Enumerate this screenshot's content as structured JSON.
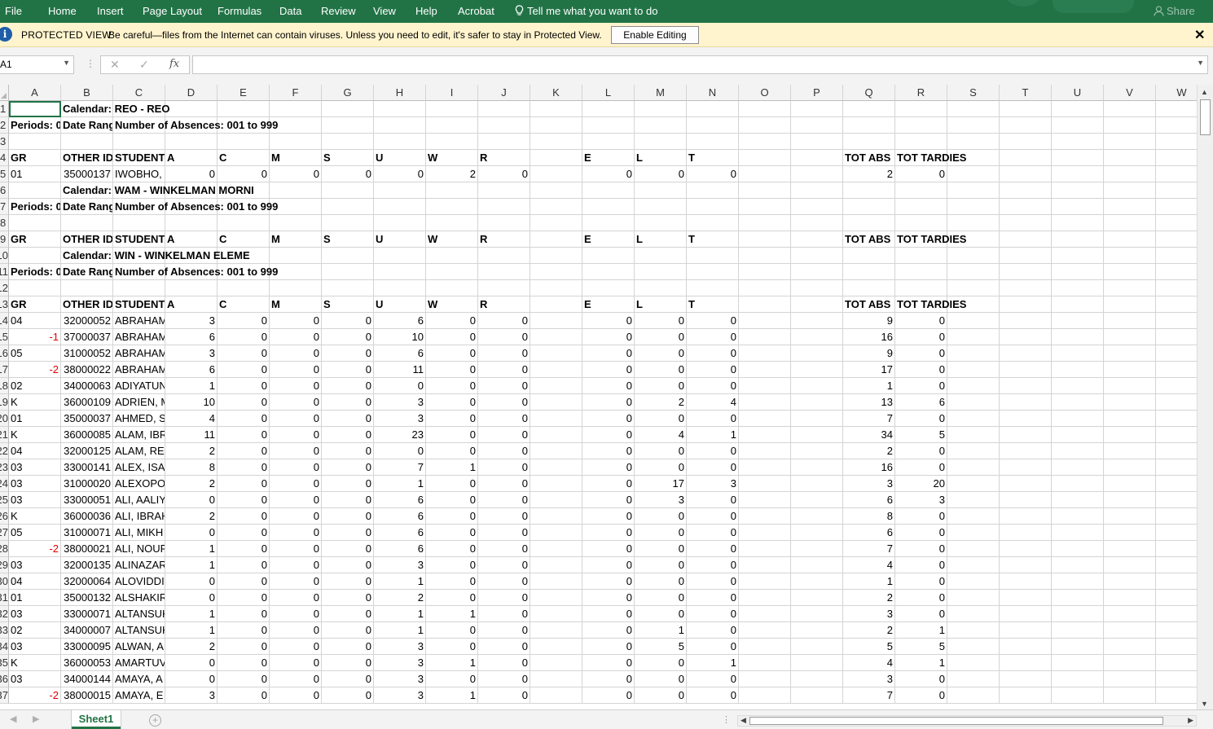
{
  "ribbon": {
    "tabs": [
      "File",
      "Home",
      "Insert",
      "Page Layout",
      "Formulas",
      "Data",
      "Review",
      "View",
      "Help",
      "Acrobat"
    ],
    "tell_me": "Tell me what you want to do",
    "share": "Share"
  },
  "protected_view": {
    "title": "PROTECTED VIEW",
    "message": "Be careful—files from the Internet can contain viruses. Unless you need to edit, it's safer to stay in Protected View.",
    "enable_button": "Enable Editing",
    "close_glyph": "✕"
  },
  "formula_bar": {
    "name_box": "A1",
    "formula": "",
    "fx_label": "fx"
  },
  "columns": [
    "A",
    "B",
    "C",
    "D",
    "E",
    "F",
    "G",
    "H",
    "I",
    "J",
    "K",
    "L",
    "M",
    "N",
    "O",
    "P",
    "Q",
    "R",
    "S",
    "T",
    "U",
    "V",
    "W"
  ],
  "rows": [
    {
      "n": "1",
      "cells": {
        "B": {
          "v": "Calendar: REO - REO",
          "b": true
        }
      }
    },
    {
      "n": "2",
      "cells": {
        "A": {
          "v": "Periods: 0",
          "b": true
        },
        "B": {
          "v": "Date Rang",
          "b": true
        },
        "C": {
          "v": "Number of Absences: 001 to 999",
          "b": true
        }
      }
    },
    {
      "n": "3",
      "cells": {}
    },
    {
      "n": "4",
      "cells": {
        "A": {
          "v": "GR",
          "b": true
        },
        "B": {
          "v": "OTHER ID",
          "b": true
        },
        "C": {
          "v": "STUDENT",
          "b": true
        },
        "D": {
          "v": "A",
          "b": true
        },
        "E": {
          "v": "C",
          "b": true
        },
        "F": {
          "v": "M",
          "b": true
        },
        "G": {
          "v": "S",
          "b": true
        },
        "H": {
          "v": "U",
          "b": true
        },
        "I": {
          "v": "W",
          "b": true
        },
        "J": {
          "v": "R",
          "b": true
        },
        "L": {
          "v": "E",
          "b": true
        },
        "M": {
          "v": "L",
          "b": true
        },
        "N": {
          "v": "T",
          "b": true
        },
        "Q": {
          "v": "TOT ABS",
          "b": true
        },
        "R": {
          "v": "TOT TARDIES",
          "b": true
        }
      }
    },
    {
      "n": "5",
      "cells": {
        "A": {
          "v": "01"
        },
        "B": {
          "v": "35000137",
          "num": true
        },
        "C": {
          "v": "IWOBHO,",
          "clip": true
        },
        "D": {
          "v": "0",
          "num": true
        },
        "E": {
          "v": "0",
          "num": true
        },
        "F": {
          "v": "0",
          "num": true
        },
        "G": {
          "v": "0",
          "num": true
        },
        "H": {
          "v": "0",
          "num": true
        },
        "I": {
          "v": "2",
          "num": true
        },
        "J": {
          "v": "0",
          "num": true
        },
        "L": {
          "v": "0",
          "num": true
        },
        "M": {
          "v": "0",
          "num": true
        },
        "N": {
          "v": "0",
          "num": true
        },
        "Q": {
          "v": "2",
          "num": true
        },
        "R": {
          "v": "0",
          "num": true
        }
      }
    },
    {
      "n": "6",
      "cells": {
        "B": {
          "v": "Calendar: WAM - WINKELMAN MORNI",
          "b": true
        }
      }
    },
    {
      "n": "7",
      "cells": {
        "A": {
          "v": "Periods: 0",
          "b": true
        },
        "B": {
          "v": "Date Rang",
          "b": true
        },
        "C": {
          "v": "Number of Absences: 001 to 999",
          "b": true
        }
      }
    },
    {
      "n": "8",
      "cells": {}
    },
    {
      "n": "9",
      "cells": {
        "A": {
          "v": "GR",
          "b": true
        },
        "B": {
          "v": "OTHER ID",
          "b": true
        },
        "C": {
          "v": "STUDENT",
          "b": true
        },
        "D": {
          "v": "A",
          "b": true
        },
        "E": {
          "v": "C",
          "b": true
        },
        "F": {
          "v": "M",
          "b": true
        },
        "G": {
          "v": "S",
          "b": true
        },
        "H": {
          "v": "U",
          "b": true
        },
        "I": {
          "v": "W",
          "b": true
        },
        "J": {
          "v": "R",
          "b": true
        },
        "L": {
          "v": "E",
          "b": true
        },
        "M": {
          "v": "L",
          "b": true
        },
        "N": {
          "v": "T",
          "b": true
        },
        "Q": {
          "v": "TOT ABS",
          "b": true
        },
        "R": {
          "v": "TOT TARDIES",
          "b": true
        }
      }
    },
    {
      "n": "10",
      "cells": {
        "B": {
          "v": "Calendar: WIN - WINKELMAN ELEME",
          "b": true
        }
      }
    },
    {
      "n": "11",
      "cells": {
        "A": {
          "v": "Periods: 0",
          "b": true
        },
        "B": {
          "v": "Date Rang",
          "b": true
        },
        "C": {
          "v": "Number of Absences: 001 to 999",
          "b": true
        }
      }
    },
    {
      "n": "12",
      "cells": {}
    },
    {
      "n": "13",
      "cells": {
        "A": {
          "v": "GR",
          "b": true
        },
        "B": {
          "v": "OTHER ID",
          "b": true
        },
        "C": {
          "v": "STUDENT",
          "b": true
        },
        "D": {
          "v": "A",
          "b": true
        },
        "E": {
          "v": "C",
          "b": true
        },
        "F": {
          "v": "M",
          "b": true
        },
        "G": {
          "v": "S",
          "b": true
        },
        "H": {
          "v": "U",
          "b": true
        },
        "I": {
          "v": "W",
          "b": true
        },
        "J": {
          "v": "R",
          "b": true
        },
        "L": {
          "v": "E",
          "b": true
        },
        "M": {
          "v": "L",
          "b": true
        },
        "N": {
          "v": "T",
          "b": true
        },
        "Q": {
          "v": "TOT ABS",
          "b": true
        },
        "R": {
          "v": "TOT TARDIES",
          "b": true
        }
      }
    },
    {
      "n": "14",
      "gr": "04",
      "id": "32000052",
      "st": "ABRAHAM",
      "d": [
        "3",
        "0",
        "0",
        "0",
        "6",
        "0",
        "0"
      ],
      "t": [
        "0",
        "0",
        "0"
      ],
      "q": "9",
      "r": "0"
    },
    {
      "n": "15",
      "gr": "-1",
      "red": true,
      "id": "37000037",
      "st": "ABRAHAM",
      "d": [
        "6",
        "0",
        "0",
        "0",
        "10",
        "0",
        "0"
      ],
      "t": [
        "0",
        "0",
        "0"
      ],
      "q": "16",
      "r": "0"
    },
    {
      "n": "16",
      "gr": "05",
      "id": "31000052",
      "st": "ABRAHAM",
      "d": [
        "3",
        "0",
        "0",
        "0",
        "6",
        "0",
        "0"
      ],
      "t": [
        "0",
        "0",
        "0"
      ],
      "q": "9",
      "r": "0"
    },
    {
      "n": "17",
      "gr": "-2",
      "red": true,
      "id": "38000022",
      "st": "ABRAHAM",
      "d": [
        "6",
        "0",
        "0",
        "0",
        "11",
        "0",
        "0"
      ],
      "t": [
        "0",
        "0",
        "0"
      ],
      "q": "17",
      "r": "0"
    },
    {
      "n": "18",
      "gr": "02",
      "id": "34000063",
      "st": "ADIYATUN",
      "d": [
        "1",
        "0",
        "0",
        "0",
        "0",
        "0",
        "0"
      ],
      "t": [
        "0",
        "0",
        "0"
      ],
      "q": "1",
      "r": "0"
    },
    {
      "n": "19",
      "gr": "K",
      "id": "36000109",
      "st": "ADRIEN, M",
      "d": [
        "10",
        "0",
        "0",
        "0",
        "3",
        "0",
        "0"
      ],
      "t": [
        "0",
        "2",
        "4"
      ],
      "q": "13",
      "r": "6"
    },
    {
      "n": "20",
      "gr": "01",
      "id": "35000037",
      "st": "AHMED, S",
      "d": [
        "4",
        "0",
        "0",
        "0",
        "3",
        "0",
        "0"
      ],
      "t": [
        "0",
        "0",
        "0"
      ],
      "q": "7",
      "r": "0"
    },
    {
      "n": "21",
      "gr": "K",
      "id": "36000085",
      "st": "ALAM, IBR",
      "d": [
        "11",
        "0",
        "0",
        "0",
        "23",
        "0",
        "0"
      ],
      "t": [
        "0",
        "4",
        "1"
      ],
      "q": "34",
      "r": "5"
    },
    {
      "n": "22",
      "gr": "04",
      "id": "32000125",
      "st": "ALAM, REI",
      "d": [
        "2",
        "0",
        "0",
        "0",
        "0",
        "0",
        "0"
      ],
      "t": [
        "0",
        "0",
        "0"
      ],
      "q": "2",
      "r": "0"
    },
    {
      "n": "23",
      "gr": "03",
      "id": "33000141",
      "st": "ALEX, ISAE",
      "d": [
        "8",
        "0",
        "0",
        "0",
        "7",
        "1",
        "0"
      ],
      "t": [
        "0",
        "0",
        "0"
      ],
      "q": "16",
      "r": "0"
    },
    {
      "n": "24",
      "gr": "03",
      "id": "31000020",
      "st": "ALEXOPOU",
      "d": [
        "2",
        "0",
        "0",
        "0",
        "1",
        "0",
        "0"
      ],
      "t": [
        "0",
        "17",
        "3"
      ],
      "q": "3",
      "r": "20"
    },
    {
      "n": "25",
      "gr": "03",
      "id": "33000051",
      "st": "ALI, AALIY",
      "d": [
        "0",
        "0",
        "0",
        "0",
        "6",
        "0",
        "0"
      ],
      "t": [
        "0",
        "3",
        "0"
      ],
      "q": "6",
      "r": "3"
    },
    {
      "n": "26",
      "gr": "K",
      "id": "36000036",
      "st": "ALI, IBRAH",
      "d": [
        "2",
        "0",
        "0",
        "0",
        "6",
        "0",
        "0"
      ],
      "t": [
        "0",
        "0",
        "0"
      ],
      "q": "8",
      "r": "0"
    },
    {
      "n": "27",
      "gr": "05",
      "id": "31000071",
      "st": "ALI, MIKH",
      "d": [
        "0",
        "0",
        "0",
        "0",
        "6",
        "0",
        "0"
      ],
      "t": [
        "0",
        "0",
        "0"
      ],
      "q": "6",
      "r": "0"
    },
    {
      "n": "28",
      "gr": "-2",
      "red": true,
      "id": "38000021",
      "st": "ALI, NOUR",
      "d": [
        "1",
        "0",
        "0",
        "0",
        "6",
        "0",
        "0"
      ],
      "t": [
        "0",
        "0",
        "0"
      ],
      "q": "7",
      "r": "0"
    },
    {
      "n": "29",
      "gr": "03",
      "id": "32000135",
      "st": "ALINAZAR",
      "d": [
        "1",
        "0",
        "0",
        "0",
        "3",
        "0",
        "0"
      ],
      "t": [
        "0",
        "0",
        "0"
      ],
      "q": "4",
      "r": "0"
    },
    {
      "n": "30",
      "gr": "04",
      "id": "32000064",
      "st": "ALOVIDDI",
      "d": [
        "0",
        "0",
        "0",
        "0",
        "1",
        "0",
        "0"
      ],
      "t": [
        "0",
        "0",
        "0"
      ],
      "q": "1",
      "r": "0"
    },
    {
      "n": "31",
      "gr": "01",
      "id": "35000132",
      "st": "ALSHAKIR",
      "d": [
        "0",
        "0",
        "0",
        "0",
        "2",
        "0",
        "0"
      ],
      "t": [
        "0",
        "0",
        "0"
      ],
      "q": "2",
      "r": "0"
    },
    {
      "n": "32",
      "gr": "03",
      "id": "33000071",
      "st": "ALTANSUK",
      "d": [
        "1",
        "0",
        "0",
        "0",
        "1",
        "1",
        "0"
      ],
      "t": [
        "0",
        "0",
        "0"
      ],
      "q": "3",
      "r": "0"
    },
    {
      "n": "33",
      "gr": "02",
      "id": "34000007",
      "st": "ALTANSUK",
      "d": [
        "1",
        "0",
        "0",
        "0",
        "1",
        "0",
        "0"
      ],
      "t": [
        "0",
        "1",
        "0"
      ],
      "q": "2",
      "r": "1"
    },
    {
      "n": "34",
      "gr": "03",
      "id": "33000095",
      "st": "ALWAN, A",
      "d": [
        "2",
        "0",
        "0",
        "0",
        "3",
        "0",
        "0"
      ],
      "t": [
        "0",
        "5",
        "0"
      ],
      "q": "5",
      "r": "5"
    },
    {
      "n": "35",
      "gr": "K",
      "id": "36000053",
      "st": "AMARTUV",
      "d": [
        "0",
        "0",
        "0",
        "0",
        "3",
        "1",
        "0"
      ],
      "t": [
        "0",
        "0",
        "1"
      ],
      "q": "4",
      "r": "1"
    },
    {
      "n": "36",
      "gr": "03",
      "id": "34000144",
      "st": "AMAYA, A",
      "d": [
        "0",
        "0",
        "0",
        "0",
        "3",
        "0",
        "0"
      ],
      "t": [
        "0",
        "0",
        "0"
      ],
      "q": "3",
      "r": "0"
    },
    {
      "n": "37",
      "gr": "-2",
      "red": true,
      "id": "38000015",
      "st": "AMAYA, E",
      "d": [
        "3",
        "0",
        "0",
        "0",
        "3",
        "1",
        "0"
      ],
      "t": [
        "0",
        "0",
        "0"
      ],
      "q": "7",
      "r": "0"
    }
  ],
  "sheet_tabs": {
    "active": "Sheet1",
    "add_glyph": "+"
  }
}
